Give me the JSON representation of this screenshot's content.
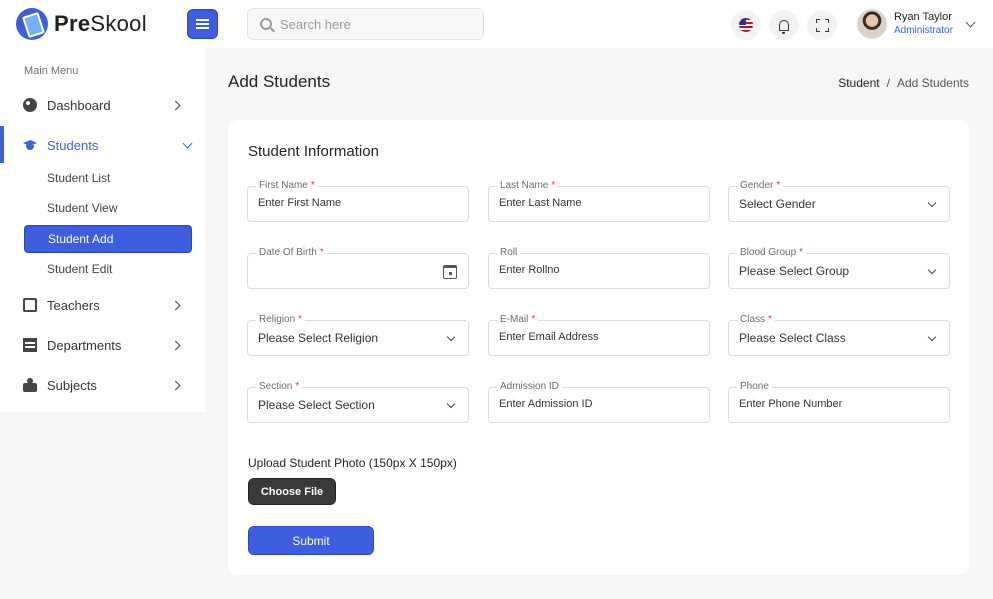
{
  "brand": {
    "name_bold": "Pre",
    "name_rest": "Skool"
  },
  "header": {
    "search_placeholder": "Search here",
    "user_name": "Ryan Taylor",
    "user_role": "Administrator",
    "accent_color": "#3d5ee1"
  },
  "sidebar": {
    "menu_title": "Main Menu",
    "items": [
      {
        "label": "Dashboard",
        "icon": "dashboard-icon"
      },
      {
        "label": "Students",
        "icon": "graduation-cap-icon",
        "expanded": true
      },
      {
        "label": "Teachers",
        "icon": "teacher-icon"
      },
      {
        "label": "Departments",
        "icon": "building-icon"
      },
      {
        "label": "Subjects",
        "icon": "subjects-icon"
      }
    ],
    "student_sub": [
      {
        "label": "Student List"
      },
      {
        "label": "Student View"
      },
      {
        "label": "Student Add",
        "active": true
      },
      {
        "label": "Student Edit"
      }
    ]
  },
  "page": {
    "title": "Add Students",
    "breadcrumb": {
      "parent": "Student",
      "separator": "/",
      "current": "Add Students"
    }
  },
  "form": {
    "title": "Student Information",
    "required_mark": "*",
    "fields": {
      "first_name": {
        "label": "First Name",
        "placeholder": "Enter First Name"
      },
      "last_name": {
        "label": "Last Name",
        "placeholder": "Enter Last Name"
      },
      "gender": {
        "label": "Gender",
        "value": "Select Gender"
      },
      "dob": {
        "label": "Date Of Birth",
        "placeholder": ""
      },
      "roll": {
        "label": "Roll",
        "placeholder": "Enter Rollno"
      },
      "blood_group": {
        "label": "Blood Group",
        "value": "Please Select Group"
      },
      "religion": {
        "label": "Religion",
        "value": "Please Select Religion"
      },
      "email": {
        "label": "E-Mail",
        "placeholder": "Enter Email Address"
      },
      "class": {
        "label": "Class",
        "value": "Please Select Class"
      },
      "section": {
        "label": "Section",
        "value": "Please Select Section"
      },
      "admission_id": {
        "label": "Admission ID",
        "placeholder": "Enter Admission ID"
      },
      "phone": {
        "label": "Phone",
        "placeholder": "Enter Phone Number"
      }
    },
    "upload_label": "Upload Student Photo (150px X 150px)",
    "choose_file_label": "Choose File",
    "submit_label": "Submit"
  }
}
